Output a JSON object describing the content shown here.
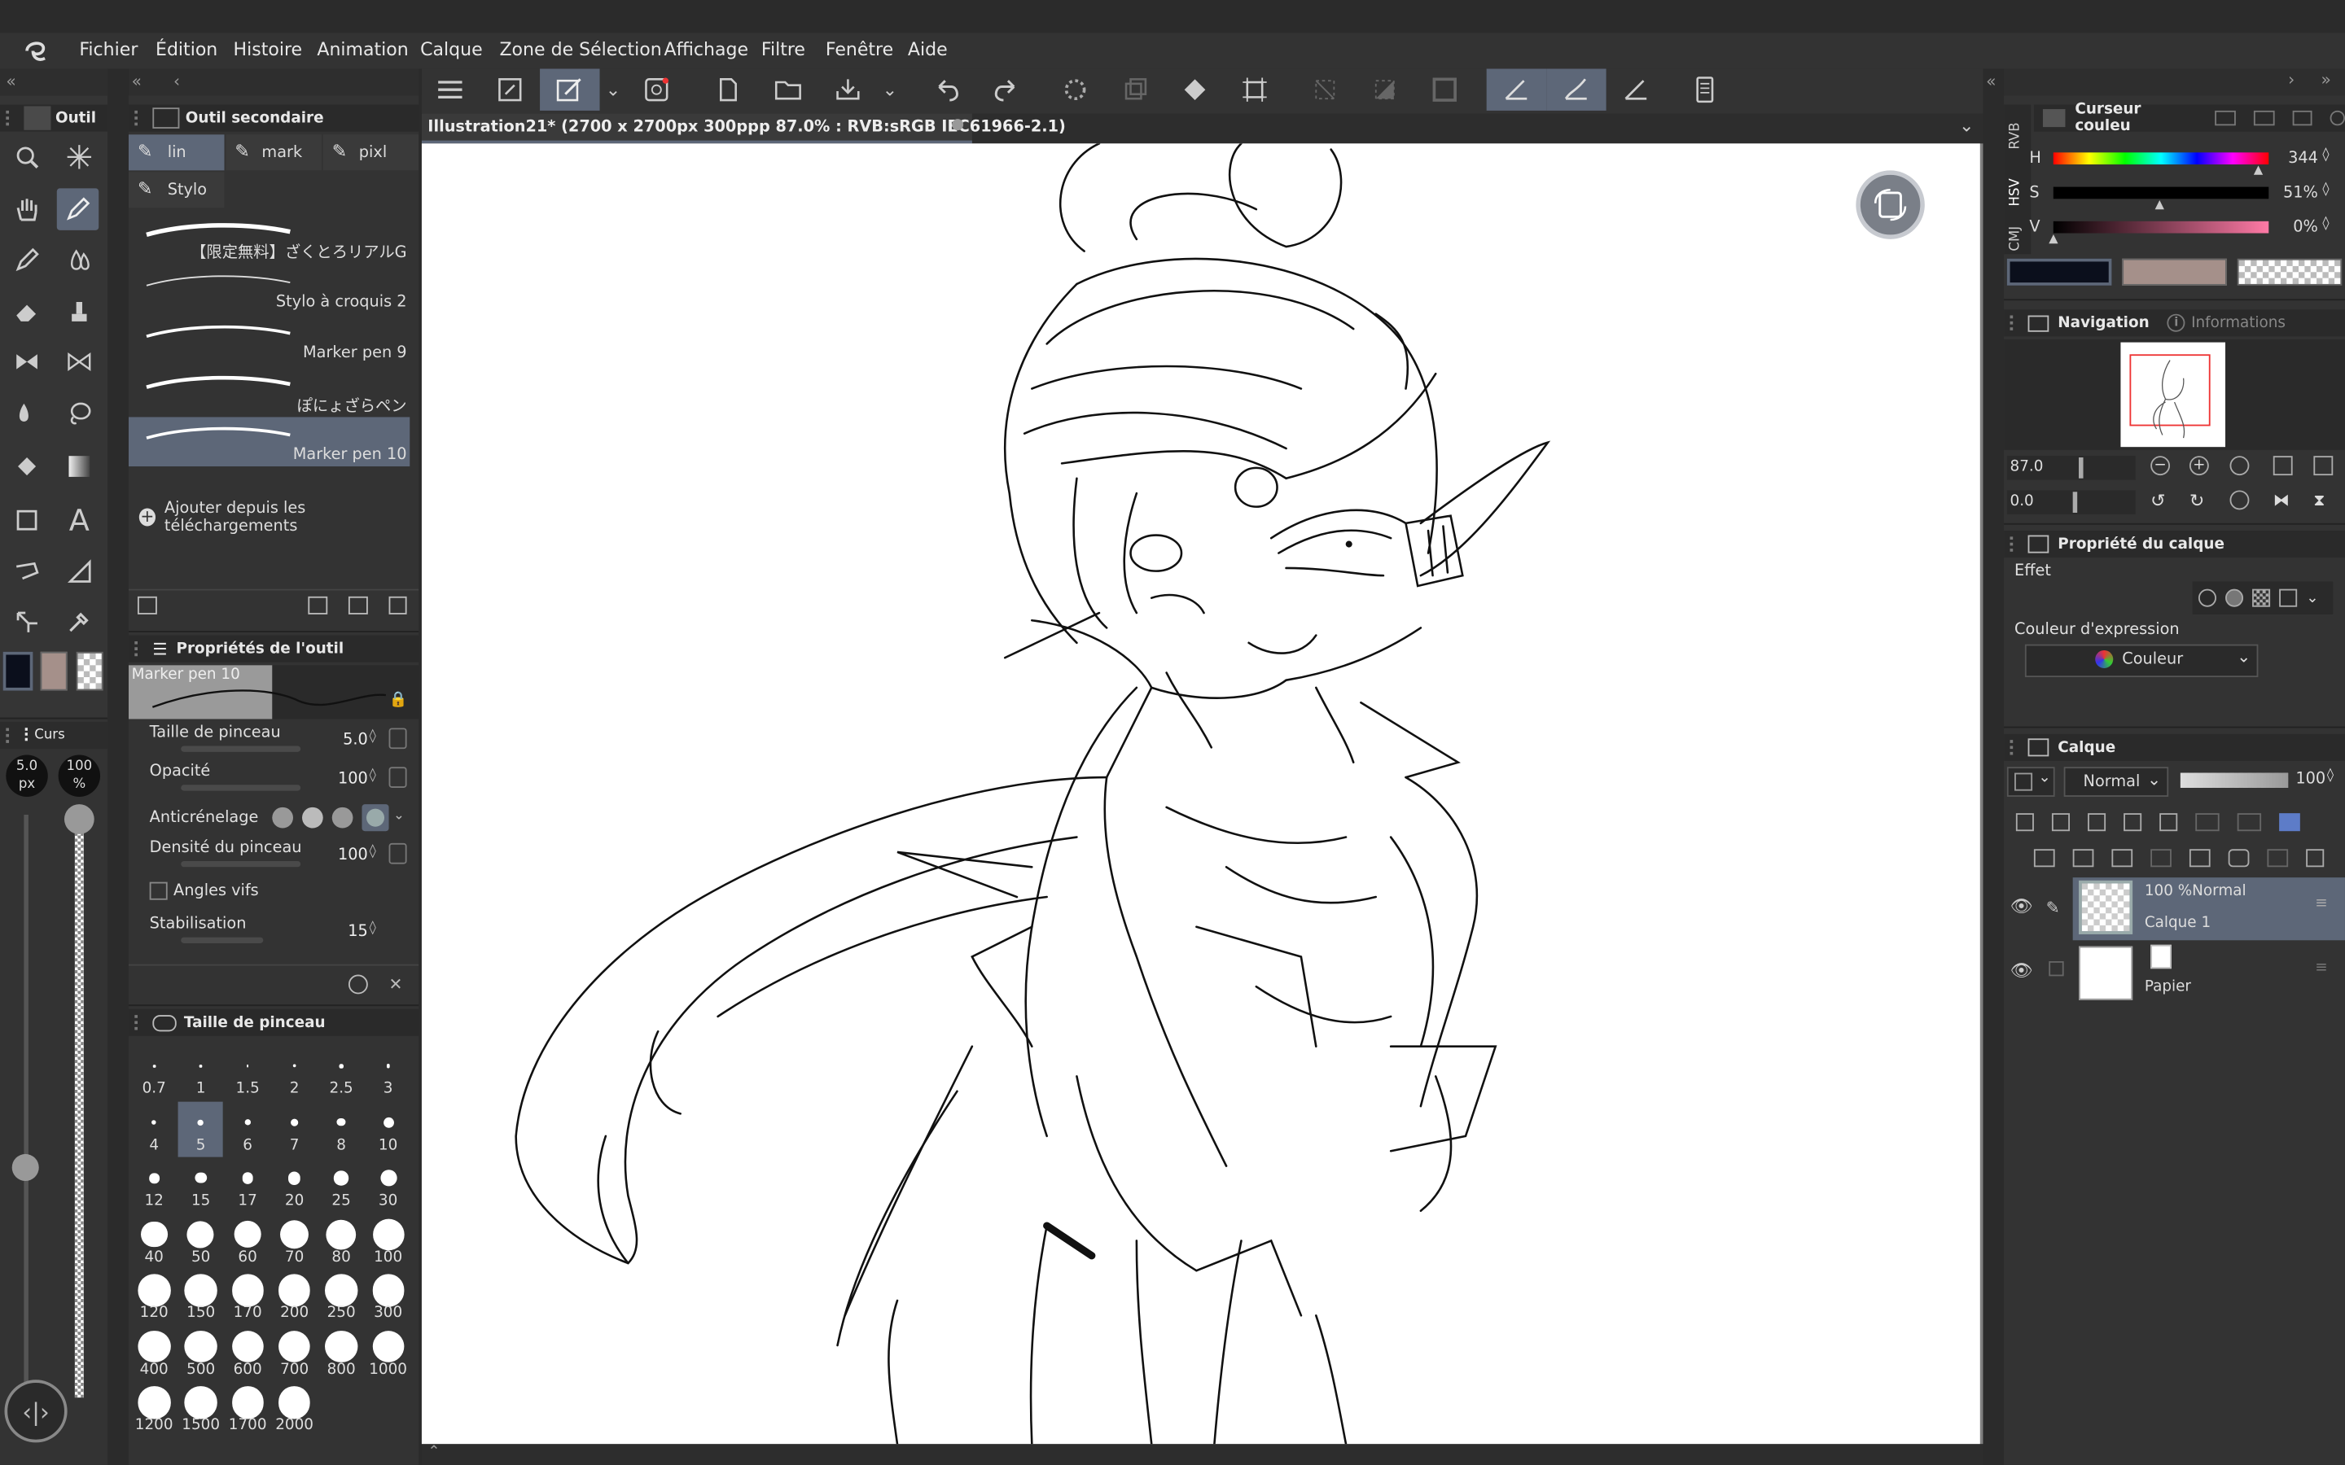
{
  "menu": {
    "items": [
      "Fichier",
      "Édition",
      "Histoire",
      "Animation",
      "Calque",
      "Zone de Sélection",
      "Affichage",
      "Filtre",
      "Fenêtre",
      "Aide"
    ]
  },
  "tool_panel": {
    "title": "Outil"
  },
  "subtool": {
    "title": "Outil secondaire",
    "tabs": [
      "lin",
      "mark",
      "pixl",
      "Stylo"
    ],
    "brushes": [
      "【限定無料】ざくとろリアルG",
      "Stylo à croquis 2",
      "Marker pen 9",
      "ぽにょざらペン",
      "Marker pen 10"
    ],
    "add_label": "Ajouter depuis les téléchargements"
  },
  "tool_props": {
    "title": "Propriétés de l'outil",
    "preview_name": "Marker pen 10",
    "rows": [
      {
        "label": "Taille de pinceau",
        "value": "5.0"
      },
      {
        "label": "Opacité",
        "value": "100"
      },
      {
        "label": "Anticrénelage",
        "value": ""
      },
      {
        "label": "Densité du pinceau",
        "value": "100"
      },
      {
        "label": "Angles vifs",
        "value": ""
      },
      {
        "label": "Stabilisation",
        "value": "15"
      }
    ]
  },
  "brush_size": {
    "title": "Taille de pinceau",
    "sizes": [
      "0.7",
      "1",
      "1.5",
      "2",
      "2.5",
      "3",
      "4",
      "5",
      "6",
      "7",
      "8",
      "10",
      "12",
      "15",
      "17",
      "20",
      "25",
      "30",
      "40",
      "50",
      "60",
      "70",
      "80",
      "100",
      "120",
      "150",
      "170",
      "200",
      "250",
      "300",
      "400",
      "500",
      "600",
      "700",
      "800",
      "1000",
      "1200",
      "1500",
      "1700",
      "2000"
    ],
    "selected": "5"
  },
  "cursor_panel": {
    "title": "Curs",
    "size_value": "5.0",
    "size_unit": "px",
    "opacity_value": "100",
    "opacity_unit": "%"
  },
  "document": {
    "tab_title": "Illustration21* (2700 x 2700px 300ppp 87.0% : RVB:sRGB IEC61966-2.1)"
  },
  "color_panel": {
    "title": "Curseur couleu",
    "side_tabs": [
      "RVB",
      "HSV",
      "CMJ"
    ],
    "h_label": "H",
    "h_value": "344",
    "s_label": "S",
    "s_value": "51%",
    "v_label": "V",
    "v_value": "0%",
    "main_color": "#0b0f1c",
    "sub_color": "#a5908a"
  },
  "navigation": {
    "title": "Navigation",
    "tab2": "Informations",
    "zoom": "87.0",
    "rotation": "0.0"
  },
  "layer_props": {
    "title": "Propriété du calque",
    "effect_label": "Effet",
    "expr_label": "Couleur d'expression",
    "expr_value": "Couleur"
  },
  "layers": {
    "title": "Calque",
    "blend": "Normal",
    "opacity": "100",
    "list": [
      {
        "top": "100 %Normal",
        "name": "Calque 1"
      },
      {
        "top": "",
        "name": "Papier"
      }
    ]
  },
  "colors": {
    "accent": "#5d6778",
    "panel": "#333333",
    "dark": "#2a2a2a",
    "titlebar": "#2b2b2b"
  }
}
